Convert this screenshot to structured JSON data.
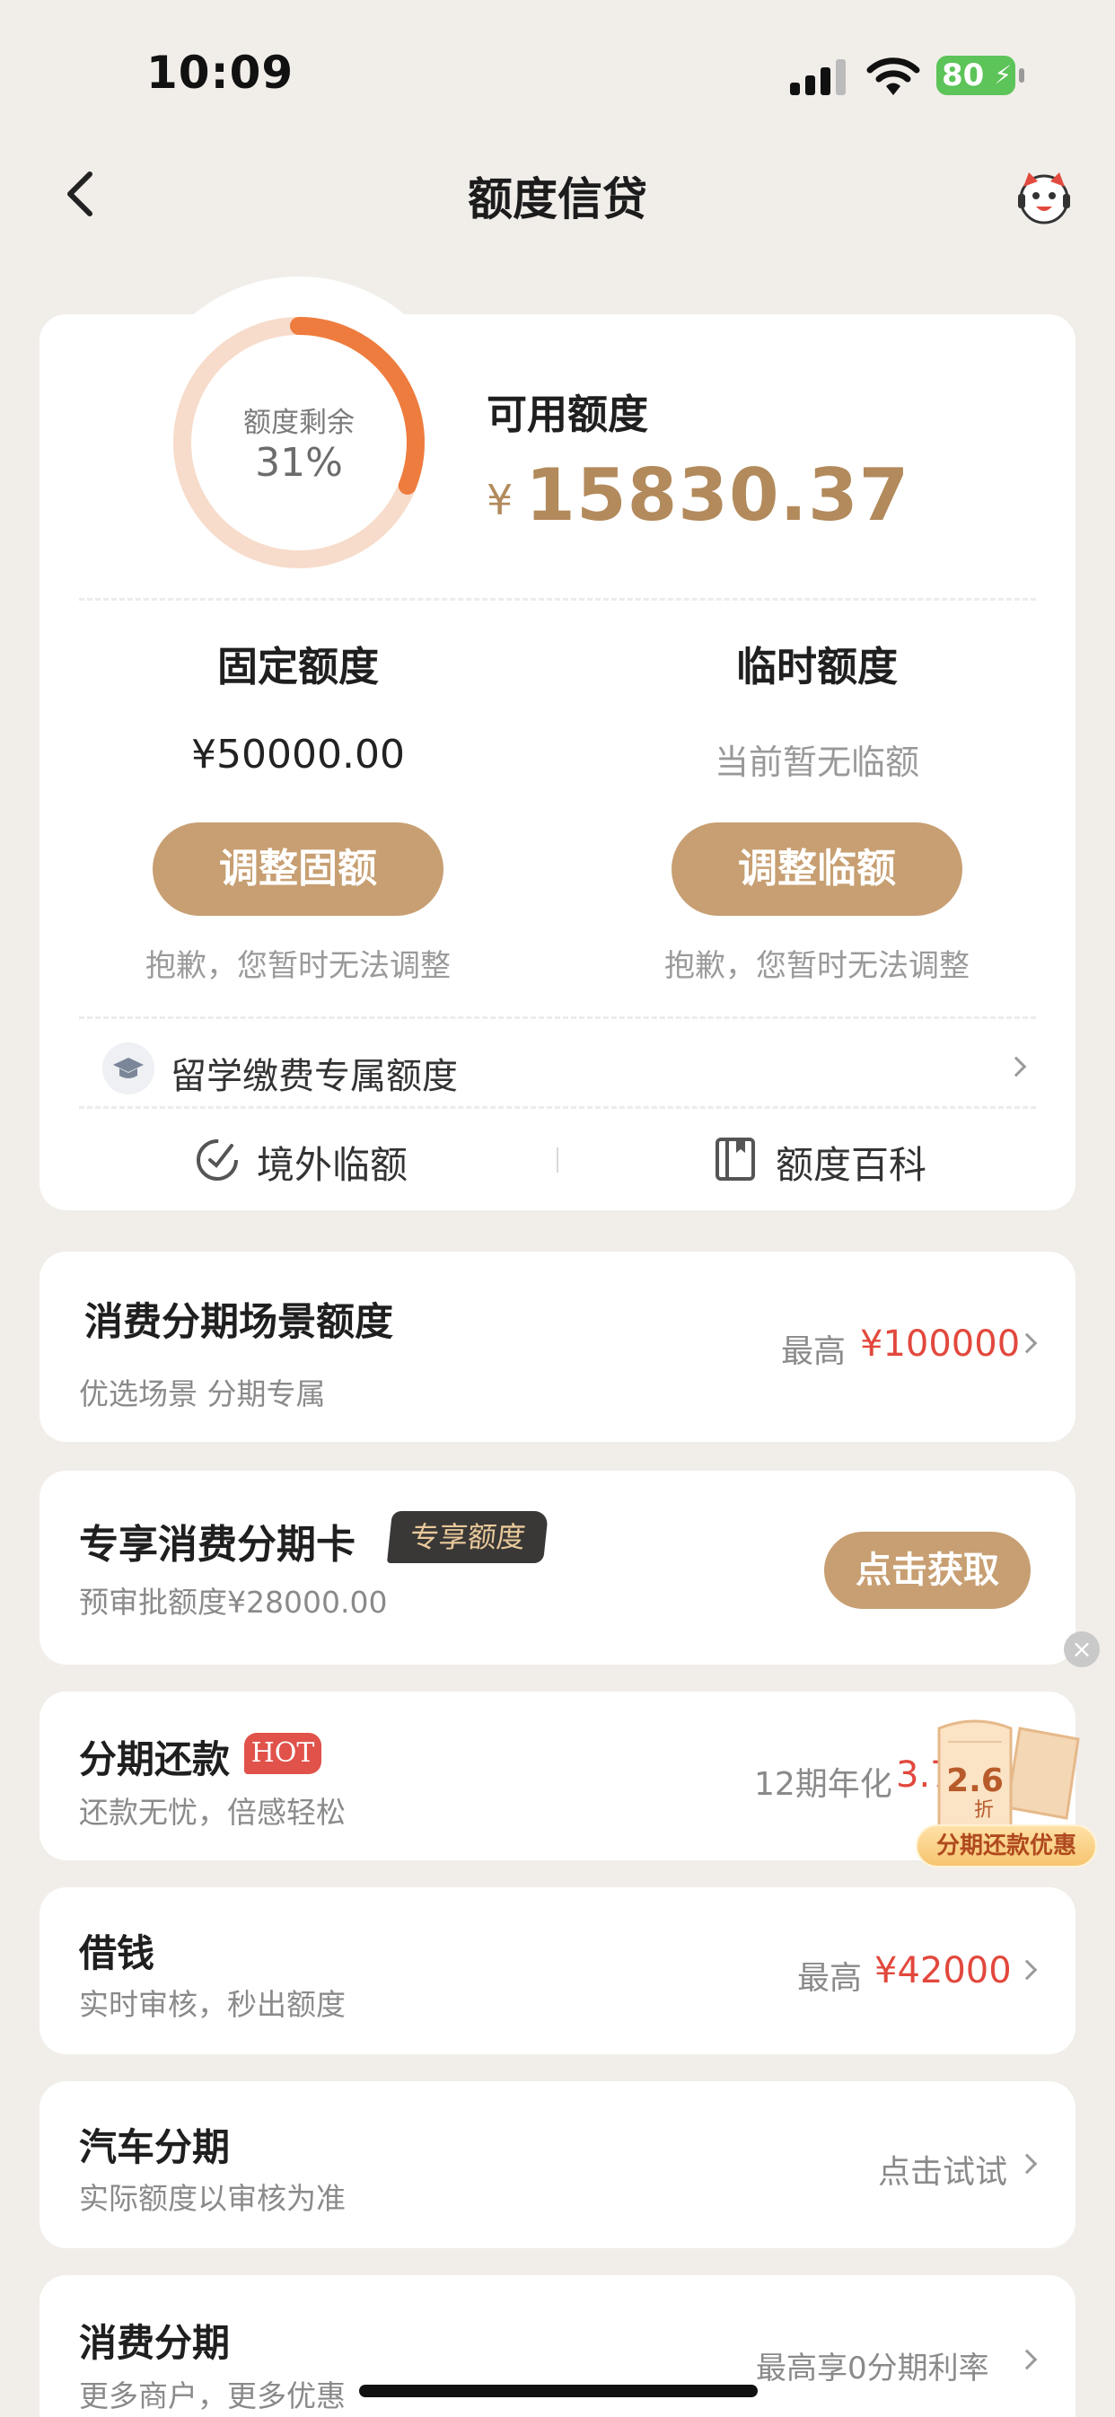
{
  "status_bar": {
    "time": "10:09",
    "battery": "80"
  },
  "nav": {
    "title": "额度信贷"
  },
  "credit": {
    "ring_label": "额度剩余",
    "ring_value": "31%",
    "remaining_fraction": 0.31,
    "available_label": "可用额度",
    "available_currency": "¥",
    "available_amount": "15830.37",
    "fixed": {
      "title": "固定额度",
      "value": "¥50000.00",
      "button": "调整固额",
      "note": "抱歉，您暂时无法调整"
    },
    "temp": {
      "title": "临时额度",
      "value": "当前暂无临额",
      "button": "调整临额",
      "note": "抱歉，您暂时无法调整"
    },
    "edu_link": "留学缴费专属额度",
    "overseas": "境外临额",
    "wiki": "额度百科"
  },
  "scene": {
    "title": "消费分期场景额度",
    "sub": "优选场景 分期专属",
    "right_prefix": "最高",
    "right_value": "¥100000"
  },
  "card_offer": {
    "title": "专享消费分期卡",
    "badge": "专享额度",
    "sub": "预审批额度¥28000.00",
    "button": "点击获取"
  },
  "installment": {
    "title": "分期还款",
    "hot": "HOT",
    "sub": "还款无忧，倍感轻松",
    "right_prefix": "12期年化",
    "right_value": "3.7"
  },
  "promo": {
    "discount": "2.6",
    "unit": "折",
    "label": "分期还款优惠"
  },
  "loan": {
    "title": "借钱",
    "sub": "实时审核，秒出额度",
    "right_prefix": "最高",
    "right_value": "¥42000"
  },
  "car": {
    "title": "汽车分期",
    "sub": "实际额度以审核为准",
    "right": "点击试试"
  },
  "consume": {
    "title": "消费分期",
    "sub": "更多商户，更多优惠",
    "right": "最高享0分期利率"
  },
  "colors": {
    "accent": "#c79f72",
    "ring": "#ee7c3e",
    "ring_track": "#f7dccb",
    "red": "#e2483d"
  }
}
